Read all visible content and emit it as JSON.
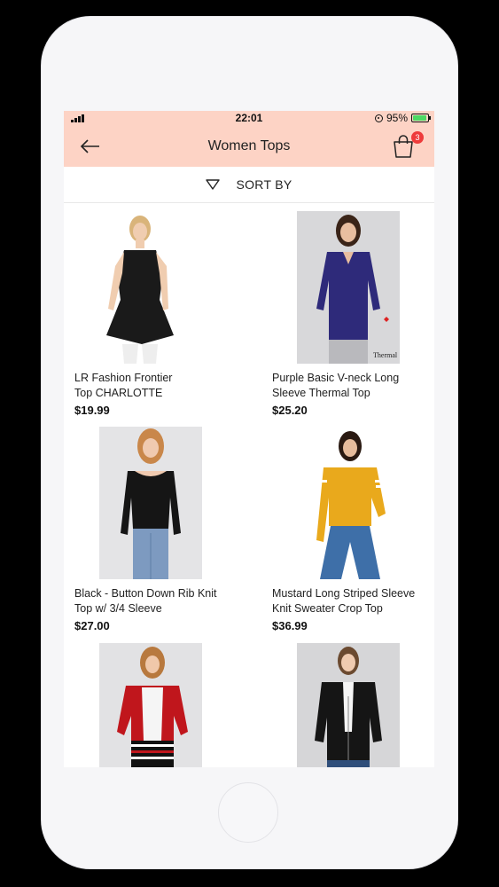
{
  "status_bar": {
    "time": "22:01",
    "battery": "95%"
  },
  "navbar": {
    "title": "Women Tops",
    "cart_count": "3"
  },
  "sort": {
    "label": "SORT BY"
  },
  "icons": {
    "back": "arrow-left-icon",
    "cart": "shopping-bag-icon",
    "sort": "triangle-down-icon"
  },
  "products": [
    {
      "name_line1": "LR Fashion Frontier",
      "name_line2": "Top CHARLOTTE",
      "price": "$19.99"
    },
    {
      "name_line1": "Purple Basic V-neck Long",
      "name_line2": "Sleeve Thermal Top",
      "price": "$25.20",
      "image_label": "Thermal"
    },
    {
      "name_line1": "Black - Button Down Rib Knit",
      "name_line2": "Top w/ 3/4 Sleeve",
      "price": "$27.00"
    },
    {
      "name_line1": "Mustard Long Striped Sleeve",
      "name_line2": "Knit Sweater Crop Top",
      "price": "$36.99"
    },
    {
      "name_line1": "",
      "name_line2": "",
      "price": ""
    },
    {
      "name_line1": "",
      "name_line2": "",
      "price": ""
    }
  ],
  "colors": {
    "header_bg": "#fdd3c5",
    "badge": "#ee3b3b"
  }
}
